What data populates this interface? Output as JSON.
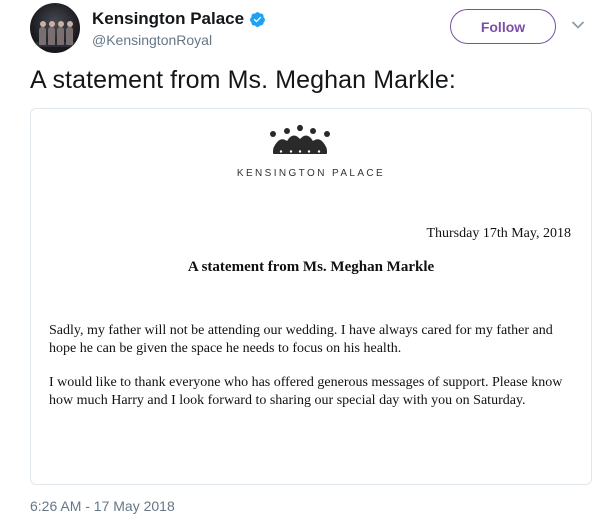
{
  "account": {
    "display_name": "Kensington Palace",
    "handle": "@KensingtonRoyal",
    "verified": true
  },
  "actions": {
    "follow_label": "Follow"
  },
  "tweet": {
    "text": "A statement from Ms. Meghan Markle:",
    "timestamp": "6:26 AM - 17 May 2018"
  },
  "letter": {
    "letterhead": "KENSINGTON PALACE",
    "date": "Thursday 17th May, 2018",
    "title": "A statement from Ms. Meghan Markle",
    "paragraphs": [
      "Sadly, my father will not be attending our wedding. I have always cared for my father and hope he can be given the space he needs to focus on his health.",
      "I would like to thank everyone who has offered generous messages of support. Please know how much Harry and I look forward to sharing our special day with you on Saturday."
    ]
  },
  "icons": {
    "verified": "verified-badge-icon",
    "menu": "chevron-down-icon",
    "logo": "crown-logo-icon"
  },
  "colors": {
    "follow_accent": "#7a4fa8",
    "verified_blue": "#1da1f2",
    "secondary_text": "#657786",
    "card_border": "#e1e8ed"
  }
}
